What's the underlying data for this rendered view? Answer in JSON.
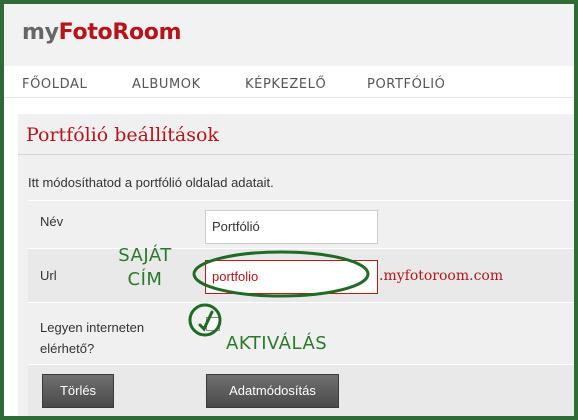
{
  "logo": {
    "part1": "my",
    "part2": "FotoRoom"
  },
  "nav": [
    "FŐOLDAL",
    "ALBUMOK",
    "KÉPKEZELŐ",
    "PORTFÓLIÓ"
  ],
  "page_title": "Portfólió beállítások",
  "intro": "Itt módosíthatod a portfólió oldalad adatait.",
  "form": {
    "name_label": "Név",
    "name_value": "Portfólió",
    "url_label": "Url",
    "url_value": "portfolio",
    "url_domain": ".myfotoroom.com",
    "public_label_line1": "Legyen interneten",
    "public_label_line2": "elérhető?",
    "public_checked": true
  },
  "buttons": {
    "delete": "Törlés",
    "save": "Adatmódosítás"
  },
  "annotations": {
    "custom_address_line1": "SAJÁT",
    "custom_address_line2": "CÍM",
    "activation": "AKTIVÁLÁS",
    "color": "#2a7a2a"
  },
  "colors": {
    "accent": "#b5141b",
    "frame": "#2f6b36"
  }
}
